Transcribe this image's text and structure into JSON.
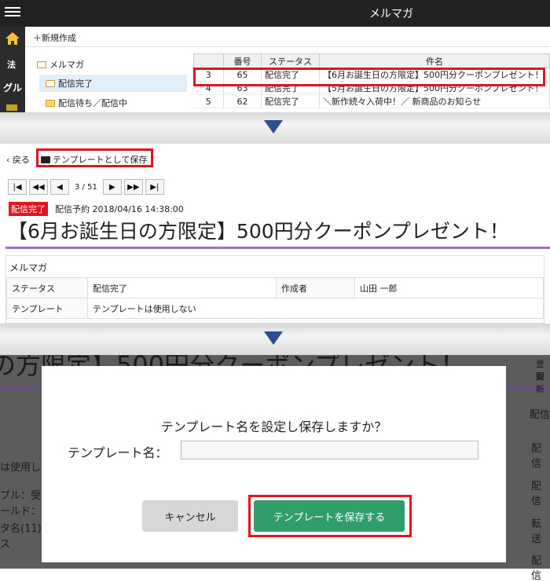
{
  "panel1": {
    "app_title": "メルマガ",
    "strip_labels": [
      "法",
      "グル"
    ],
    "new_label": "＋新規作成",
    "tree": [
      "メルマガ",
      "配信完了",
      "配信待ち／配信中"
    ],
    "columns": [
      "番号",
      "ステータス",
      "件名"
    ],
    "rows": [
      {
        "idx": "3",
        "no": "65",
        "status": "配信完了",
        "subject": "【6月お誕生日の方限定】500円分クーポンプレゼント！"
      },
      {
        "idx": "4",
        "no": "63",
        "status": "配信完了",
        "subject": "【5月お誕生日の方限定】500円分クーポンプレゼント！"
      },
      {
        "idx": "5",
        "no": "62",
        "status": "配信完了",
        "subject": "＼新作続々入荷中！／ 新商品のお知らせ"
      }
    ]
  },
  "panel2": {
    "back_label": "戻る",
    "save_template_label": "テンプレートとして保存",
    "pager": "3 / 51",
    "badge": "配信完了",
    "schedule": "配信予約 2018/04/16 14:38:00",
    "title": "【6月お誕生日の方限定】500円分クーポンプレゼント！",
    "card_title": "メルマガ",
    "info": {
      "status_label": "ステータス",
      "status_value": "配信完了",
      "author_label": "作成者",
      "author_value": "山田 一郎",
      "template_label": "テンプレート",
      "template_value": "テンプレートは使用しない"
    }
  },
  "panel3": {
    "bg_title": "の方限定】500円分クーポンプレゼント！",
    "bg_left": [
      "は使用し",
      "ブル：受",
      "ールド：",
      "タ名(11)",
      "ス"
    ],
    "bg_right_top": [
      "登録",
      "更新"
    ],
    "bg_right": [
      "配信",
      "配信",
      "配信",
      "転送",
      "配信"
    ],
    "question": "テンプレート名を設定し保存しますか？",
    "name_label": "テンプレート名：",
    "name_value": "",
    "cancel_label": "キャンセル",
    "save_label": "テンプレートを保存する"
  }
}
